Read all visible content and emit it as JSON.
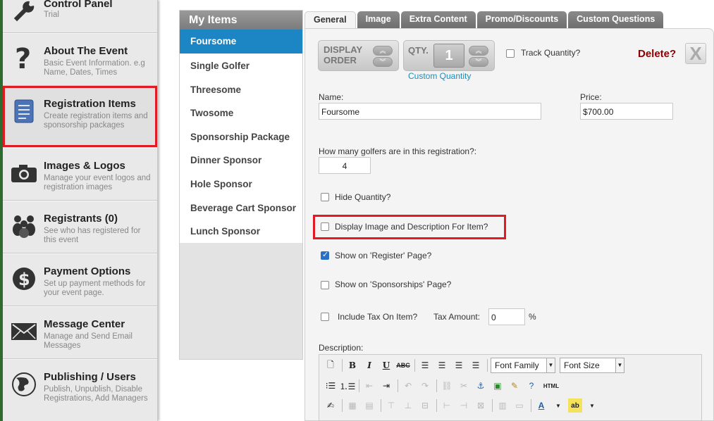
{
  "sidebar": {
    "items": [
      {
        "title": "Control Panel",
        "subtitle": "Trial",
        "icon": "wrench-icon"
      },
      {
        "title": "About The Event",
        "subtitle": "Basic Event Information. e.g Name, Dates, Times",
        "icon": "question-icon"
      },
      {
        "title": "Registration Items",
        "subtitle": "Create registration items and sponsorship packages",
        "icon": "document-icon"
      },
      {
        "title": "Images & Logos",
        "subtitle": "Manage your event logos and registration images",
        "icon": "camera-icon"
      },
      {
        "title": "Registrants (0)",
        "subtitle": "See who has registered for this event",
        "icon": "people-icon"
      },
      {
        "title": "Payment Options",
        "subtitle": "Set up payment methods for your event page.",
        "icon": "dollar-icon"
      },
      {
        "title": "Message Center",
        "subtitle": "Manage and Send Email Messages",
        "icon": "envelope-icon"
      },
      {
        "title": "Publishing / Users",
        "subtitle": "Publish, Unpublish, Disable Registrations, Add Managers",
        "icon": "globe-icon"
      }
    ]
  },
  "my_items": {
    "header": "My Items",
    "items": [
      "Foursome",
      "Single Golfer",
      "Threesome",
      "Twosome",
      "Sponsorship Package",
      "Dinner Sponsor",
      "Hole Sponsor",
      "Beverage Cart Sponsor",
      "Lunch Sponsor"
    ],
    "selected": "Foursome"
  },
  "tabs": [
    "General",
    "Image",
    "Extra Content",
    "Promo/Discounts",
    "Custom Questions"
  ],
  "form": {
    "display_order_label_1": "DISPLAY",
    "display_order_label_2": "ORDER",
    "qty_label": "QTY.",
    "qty_value": "1",
    "custom_quantity_link": "Custom Quantity",
    "track_quantity_label": "Track Quantity?",
    "delete_label": "Delete?",
    "close_label": "X",
    "name_label": "Name:",
    "name_value": "Foursome",
    "price_label": "Price:",
    "price_value": "$700.00",
    "golfers_label": "How many golfers are in this registration?:",
    "golfers_value": "4",
    "hide_quantity_label": "Hide Quantity?",
    "display_image_label": "Display Image and Description For Item?",
    "show_register_label": "Show on 'Register' Page?",
    "show_sponsorships_label": "Show on 'Sponsorships' Page?",
    "include_tax_label": "Include Tax On Item?",
    "tax_amount_label": "Tax Amount:",
    "tax_amount_value": "0",
    "percent_sign": "%",
    "description_label": "Description:"
  },
  "editor": {
    "font_family": "Font Family",
    "font_size": "Font Size",
    "html_label": "HTML"
  },
  "colors": {
    "accent_blue": "#1c85c4",
    "highlight_red": "#e01b24",
    "delete_red": "#8b0000",
    "link_teal": "#1b8cb5"
  }
}
